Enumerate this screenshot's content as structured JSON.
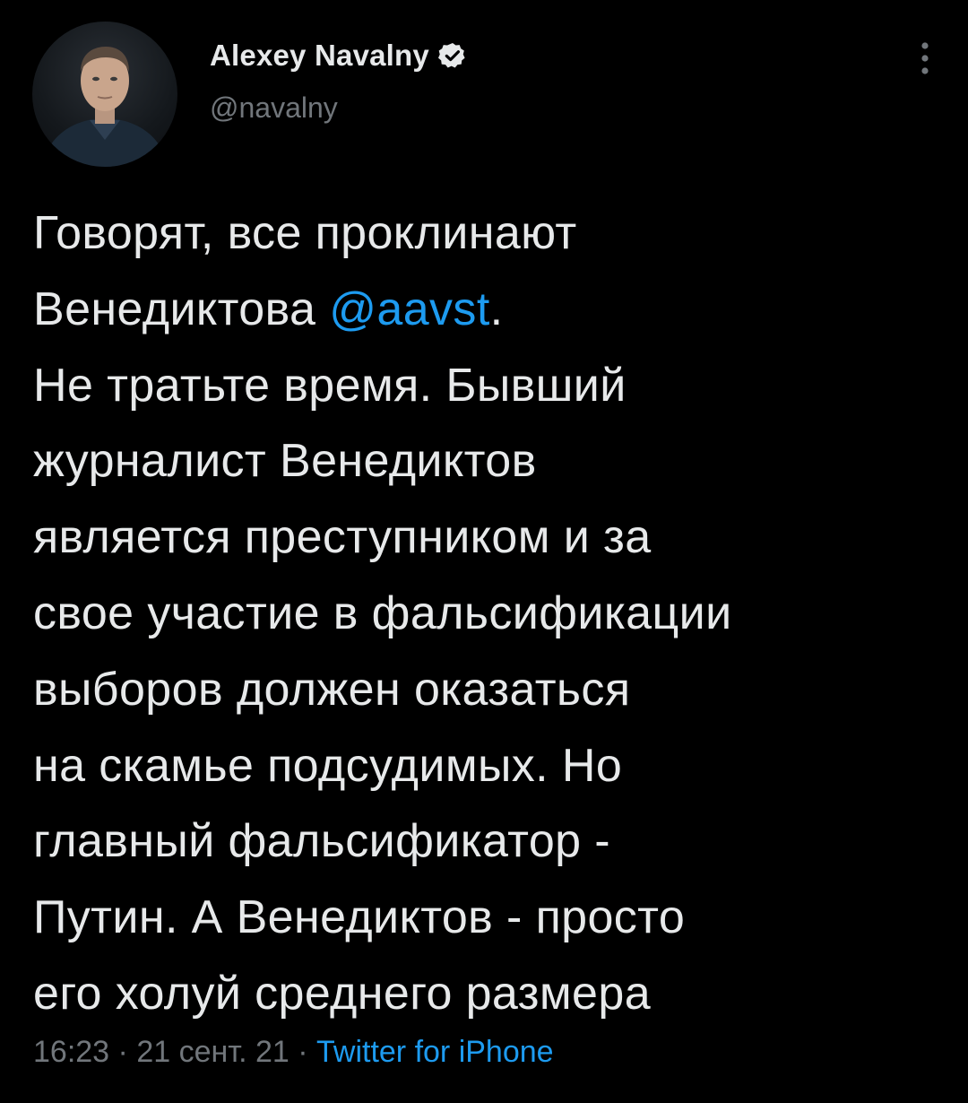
{
  "author": {
    "display_name": "Alexey Navalny",
    "handle": "@navalny",
    "verified": true,
    "avatar_icon": "profile-photo"
  },
  "tweet": {
    "line1": "Говорят, все проклинают",
    "line2_pre": "Венедиктова ",
    "mention": "@aavst",
    "line2_post": ".",
    "rest": "Не тратьте время. Бывший\nжурналист Венедиктов\nявляется преступником и за\nсвое участие в фальсификации\nвыборов должен оказаться\nна скамье подсудимых. Но\nглавный фальсификатор -\nПутин. А Венедиктов - просто\nего холуй среднего размера"
  },
  "meta": {
    "time": "16:23",
    "sep1": " · ",
    "date": "21 сент. 21",
    "sep2": " · ",
    "source": "Twitter for iPhone"
  },
  "colors": {
    "background": "#000000",
    "text": "#e7e9ea",
    "secondary": "#71767b",
    "accent": "#1d9bf0"
  },
  "icons": {
    "verified": "verified-badge-icon",
    "more": "more-vertical-icon"
  }
}
